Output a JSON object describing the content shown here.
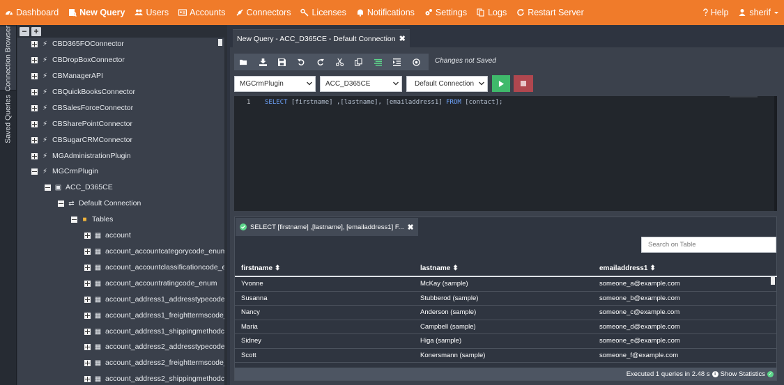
{
  "nav": {
    "items": [
      {
        "label": "Dashboard",
        "icon": "dashboard-icon"
      },
      {
        "label": "New Query",
        "icon": "new-query-icon"
      },
      {
        "label": "Users",
        "icon": "users-icon"
      },
      {
        "label": "Accounts",
        "icon": "accounts-icon"
      },
      {
        "label": "Connectors",
        "icon": "connectors-icon"
      },
      {
        "label": "Licenses",
        "icon": "key-icon"
      },
      {
        "label": "Notifications",
        "icon": "bell-icon"
      },
      {
        "label": "Settings",
        "icon": "gears-icon"
      },
      {
        "label": "Logs",
        "icon": "logs-icon"
      },
      {
        "label": "Restart Server",
        "icon": "refresh-icon"
      }
    ],
    "help": "Help",
    "user": "sherif"
  },
  "side_tabs": {
    "connection_browser": "Connection Browser",
    "saved_queries": "Saved Queries"
  },
  "tree": {
    "items": [
      "CBD365FOConnector",
      "CBDropBoxConnector",
      "CBManagerAPI",
      "CBQuickBooksConnector",
      "CBSalesForceConnector",
      "CBSharePointConnector",
      "CBSugarCRMConnector",
      "MGAdministrationPlugin",
      "MGCrmPlugin",
      "ACC_D365CE",
      "Default Connection",
      "Tables",
      "account",
      "account_accountcategorycode_enum",
      "account_accountclassificationcode_enum",
      "account_accountratingcode_enum",
      "account_address1_addresstypecode_enu",
      "account_address1_freighttermscode_enu",
      "account_address1_shippingmethodcode_",
      "account_address2_addresstypecode_enu",
      "account_address2_freighttermscode_enu",
      "account_address2_shippingmethodcode_"
    ]
  },
  "editor_tab": {
    "title": "New Query - ACC_D365CE - Default Connection"
  },
  "toolbar": {
    "status": "Changes not Saved"
  },
  "selects": {
    "plugin": "MGCrmPlugin",
    "connector": "ACC_D365CE",
    "connection": "Default Connection"
  },
  "editor": {
    "line_number": "1",
    "kw_select": "SELECT",
    "fields": " [firstname] ,[lastname], [emailaddress1] ",
    "kw_from": "FROM",
    "table": " [contact];"
  },
  "results": {
    "tab_title": "SELECT [firstname] ,[lastname], [emailaddress1] F...",
    "search_placeholder": "Search on Table",
    "columns": [
      "firstname",
      "lastname",
      "emailaddress1"
    ],
    "rows": [
      [
        "Yvonne",
        "McKay (sample)",
        "someone_a@example.com"
      ],
      [
        "Susanna",
        "Stubberod (sample)",
        "someone_b@example.com"
      ],
      [
        "Nancy",
        "Anderson (sample)",
        "someone_c@example.com"
      ],
      [
        "Maria",
        "Campbell (sample)",
        "someone_d@example.com"
      ],
      [
        "Sidney",
        "Higa (sample)",
        "someone_e@example.com"
      ],
      [
        "Scott",
        "Konersmann (sample)",
        "someone_f@example.com"
      ]
    ],
    "status": "Executed 1 queries in 2.48 s",
    "show_stats": "Show Statistics"
  },
  "colors": {
    "accent": "#f07b2a",
    "run": "#3fb96b",
    "stop": "#b0474f"
  }
}
